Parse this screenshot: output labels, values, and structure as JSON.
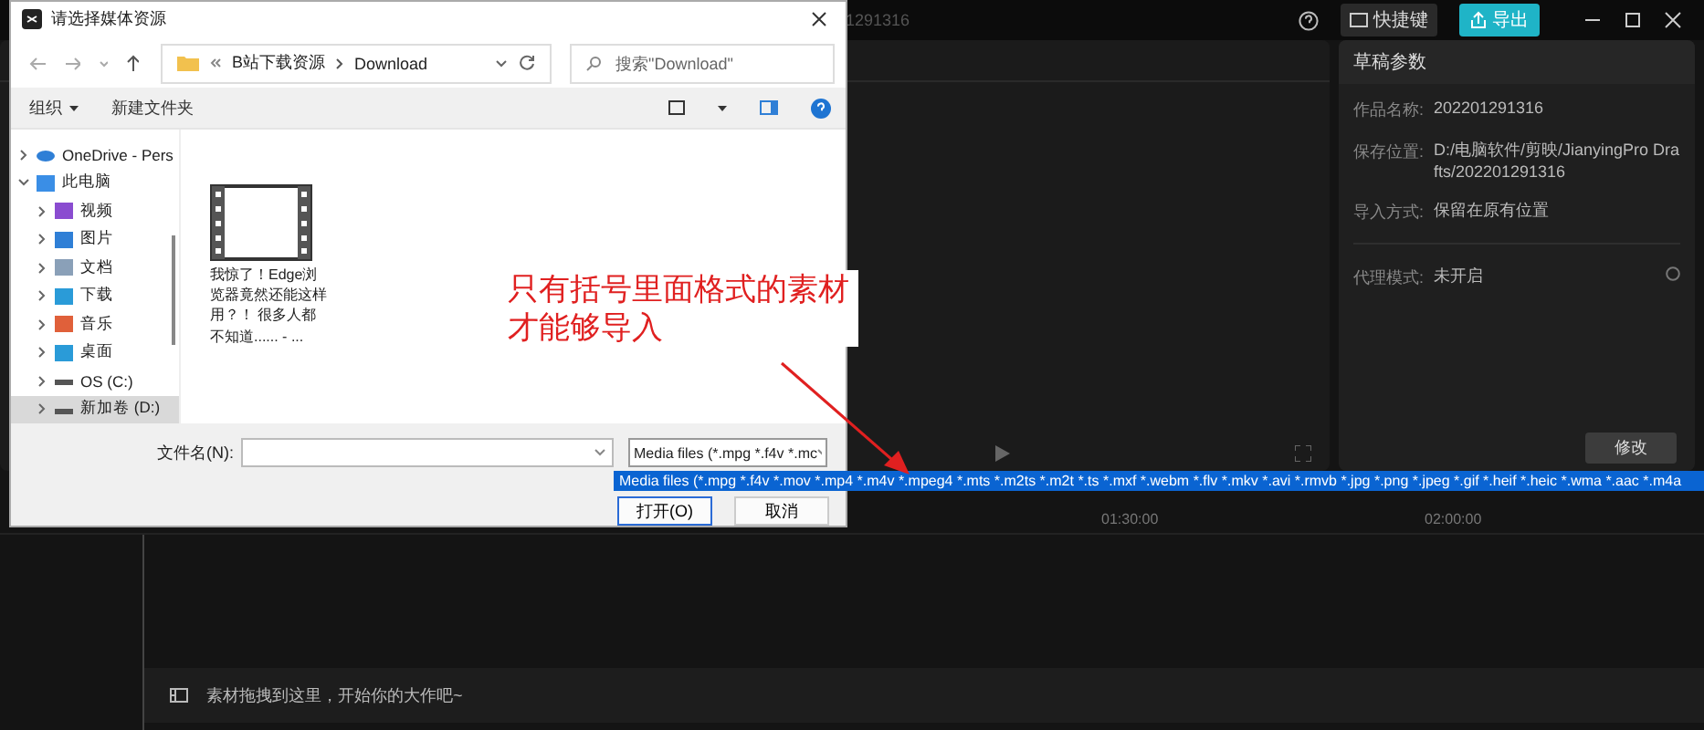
{
  "app": {
    "title_fragment": "1291316",
    "shortcut_button": "快捷键",
    "export_button": "导出"
  },
  "draft_panel": {
    "title": "草稿参数",
    "rows": [
      {
        "label": "作品名称:",
        "value": "202201291316"
      },
      {
        "label": "保存位置:",
        "value": "D:/电脑软件/剪映/JianyingPro Drafts/202201291316"
      },
      {
        "label": "导入方式:",
        "value": "保留在原有位置"
      }
    ],
    "proxy": {
      "label": "代理模式:",
      "value": "未开启"
    },
    "edit_button": "修改"
  },
  "timeline": {
    "ruler": [
      "01:30:00",
      "02:00:00"
    ],
    "track_hint": "素材拖拽到这里，开始你的大作吧~"
  },
  "dialog": {
    "title": "请选择媒体资源",
    "breadcrumb": [
      "B站下载资源",
      "Download"
    ],
    "search": {
      "placeholder": "搜索\"Download\""
    },
    "toolbar": [
      "组织",
      "新建文件夹"
    ],
    "tree": [
      {
        "label": "OneDrive - Pers",
        "kind": "cloud",
        "expanded": false,
        "selected": false
      },
      {
        "label": "此电脑",
        "kind": "pc",
        "expanded": true,
        "selected": false,
        "children": [
          {
            "label": "视频",
            "kind": "video",
            "expanded": false,
            "selected": false
          },
          {
            "label": "图片",
            "kind": "picture",
            "expanded": false,
            "selected": false
          },
          {
            "label": "文档",
            "kind": "doc",
            "expanded": false,
            "selected": false
          },
          {
            "label": "下载",
            "kind": "download",
            "expanded": false,
            "selected": false
          },
          {
            "label": "音乐",
            "kind": "music",
            "expanded": false,
            "selected": false
          },
          {
            "label": "桌面",
            "kind": "desktop",
            "expanded": false,
            "selected": false
          },
          {
            "label": "OS (C:)",
            "kind": "drive",
            "expanded": false,
            "selected": false
          },
          {
            "label": "新加卷 (D:)",
            "kind": "drive",
            "expanded": false,
            "selected": true
          }
        ]
      }
    ],
    "files": [
      {
        "name": "我惊了！Edge浏览器竟然还能这样用？！ 很多人都不知道...... - ..."
      }
    ],
    "filename_label": "文件名(N):",
    "file_type": "Media files (*.mpg *.f4v *.mc",
    "file_type_options": [
      {
        "label": "Media files (*.mpg *.f4v *.mov *.mp4 *.m4v *.mpeg4 *.mts *.m2ts *.m2t *.ts *.mxf *.webm *.flv *.mkv *.avi *.rmvb *.jpg *.png *.jpeg *.gif *.heif *.heic *.wma *.aac *.m4a",
        "selected": true
      }
    ],
    "buttons": [
      "打开(O)",
      "取消"
    ]
  },
  "annotation": {
    "text": "只有括号里面格式的素材才能够导入"
  }
}
